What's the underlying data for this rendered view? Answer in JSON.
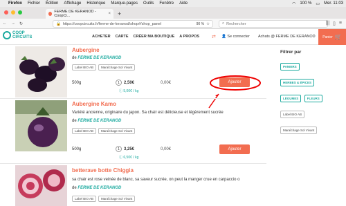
{
  "menubar": {
    "app": "Firefox",
    "items": [
      "Fichier",
      "Édition",
      "Affichage",
      "Historique",
      "Marque-pages",
      "Outils",
      "Fenêtre",
      "Aide"
    ],
    "battery": "100 %",
    "clock": "Mer. 11:03"
  },
  "browser": {
    "tab_title": "FERME DE KERANOD - CoopCi...",
    "url": "https://coopcircuits.fr/ferme-de-keranod/shop#/shop_panel",
    "url_domain": "coopcircuits.fr",
    "zoom": "90 %",
    "search_placeholder": "Rechercher"
  },
  "site": {
    "logo_line1": "COOP",
    "logo_line2": "CIRCUITS",
    "nav": [
      "ACHETER",
      "CARTE",
      "CRÉER MA BOUTIQUE",
      "A PROPOS"
    ],
    "connect": "Se connecter",
    "achats": "Achats @ FERME DE KERANOD",
    "panier": "Panier",
    "cart_count": "0"
  },
  "products": [
    {
      "title": "Aubergine",
      "farm_prefix": "de",
      "farm": "FERME DE KERANOD",
      "tags": [
        "Label BIO AB",
        "Maraîchage Sol Vivant"
      ],
      "weight": "500g",
      "qty": "1",
      "price": "2,50€",
      "unit_price": "5,00€ / kg",
      "total": "0,00€",
      "button": "Ajouter",
      "description": ""
    },
    {
      "title": "Aubergine Kamo",
      "description": "Variété ancienne, originaire du japon. Sa chair est délicieuse et légèrement sucrée",
      "farm_prefix": "de",
      "farm": "FERME DE KERANOD",
      "tags": [
        "Label BIO AB",
        "Maraîchage Sol Vivant"
      ],
      "weight": "500g",
      "qty": "1",
      "price": "3,25€",
      "unit_price": "6,50€ / kg",
      "total": "0,00€",
      "button": "Ajouter"
    },
    {
      "title": "betterave botte Chiggia",
      "description": "sa chair est rose veinée de blanc, sa saveur sucrée, on peut la manger crue en carpaccio o",
      "farm_prefix": "de",
      "farm": "FERME DE KERANOD",
      "tags": [
        "Label BIO AB",
        "Maraîchage Sol Vivant"
      ]
    }
  ],
  "filters": {
    "title": "Filtrer par",
    "categories": [
      "PANIERS",
      "HERBES & ÉPICES",
      "LÉGUMES",
      "FLEURS"
    ],
    "labels": [
      "Label BIO AB",
      "Maraîchage Sol Vivant"
    ]
  },
  "colors": {
    "accent": "#f26d50",
    "teal": "#1aa99e"
  }
}
